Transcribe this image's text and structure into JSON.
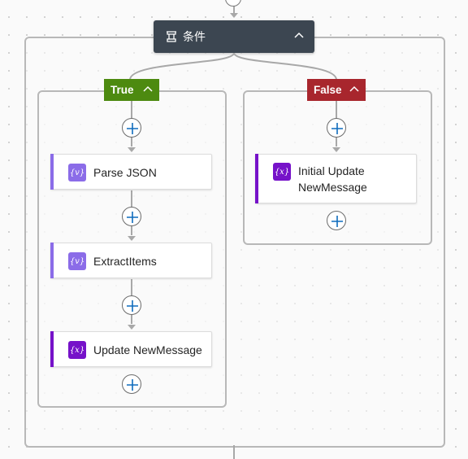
{
  "condition": {
    "title": "条件",
    "icon": "condition-icon",
    "header_color": "#3c4651"
  },
  "true_branch": {
    "label": "True",
    "color": "#4d8a10",
    "actions": [
      {
        "label": "Parse JSON",
        "icon": "parse-json-icon",
        "accent": "#8b6ce8"
      },
      {
        "label": "ExtractItems",
        "icon": "parse-json-icon",
        "accent": "#8b6ce8"
      },
      {
        "label": "Update NewMessage",
        "icon": "variable-icon",
        "accent": "#7612c9"
      }
    ]
  },
  "false_branch": {
    "label": "False",
    "color": "#a8262d",
    "actions": [
      {
        "label_line1": "Initial Update",
        "label_line2": "NewMessage",
        "icon": "variable-icon",
        "accent": "#7612c9"
      }
    ]
  },
  "icons": {
    "variable_glyph": "{x}",
    "parse_glyph": "{v}"
  }
}
